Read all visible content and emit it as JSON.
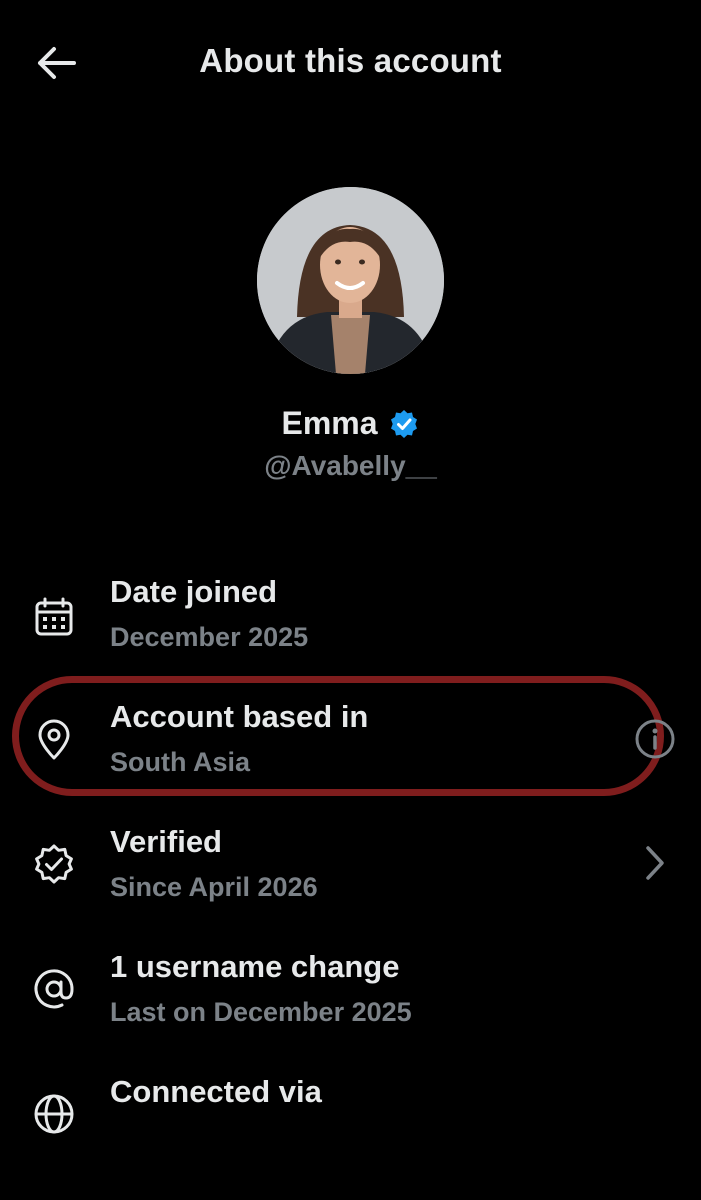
{
  "header": {
    "title": "About this account",
    "back_icon": "arrow-left-icon"
  },
  "profile": {
    "name": "Emma",
    "handle": "@Avabelly__",
    "verified": true,
    "badge_color": "#1d9bf0"
  },
  "rows": [
    {
      "icon": "calendar-icon",
      "title": "Date joined",
      "subtitle": "December 2025"
    },
    {
      "icon": "location-pin-icon",
      "title": "Account based in",
      "subtitle": "South Asia",
      "trailing": "info-icon",
      "highlighted": true,
      "highlight_color": "#7f1d1d"
    },
    {
      "icon": "verified-badge-outline-icon",
      "title": "Verified",
      "subtitle": "Since April 2026",
      "trailing": "chevron-right-icon"
    },
    {
      "icon": "at-sign-icon",
      "title": "1 username change",
      "subtitle": "Last on December 2025"
    },
    {
      "icon": "globe-icon",
      "title": "Connected via",
      "subtitle": ""
    }
  ],
  "colors": {
    "background": "#000000",
    "primary_text": "#e7e9ea",
    "secondary_text": "#7c8288"
  }
}
